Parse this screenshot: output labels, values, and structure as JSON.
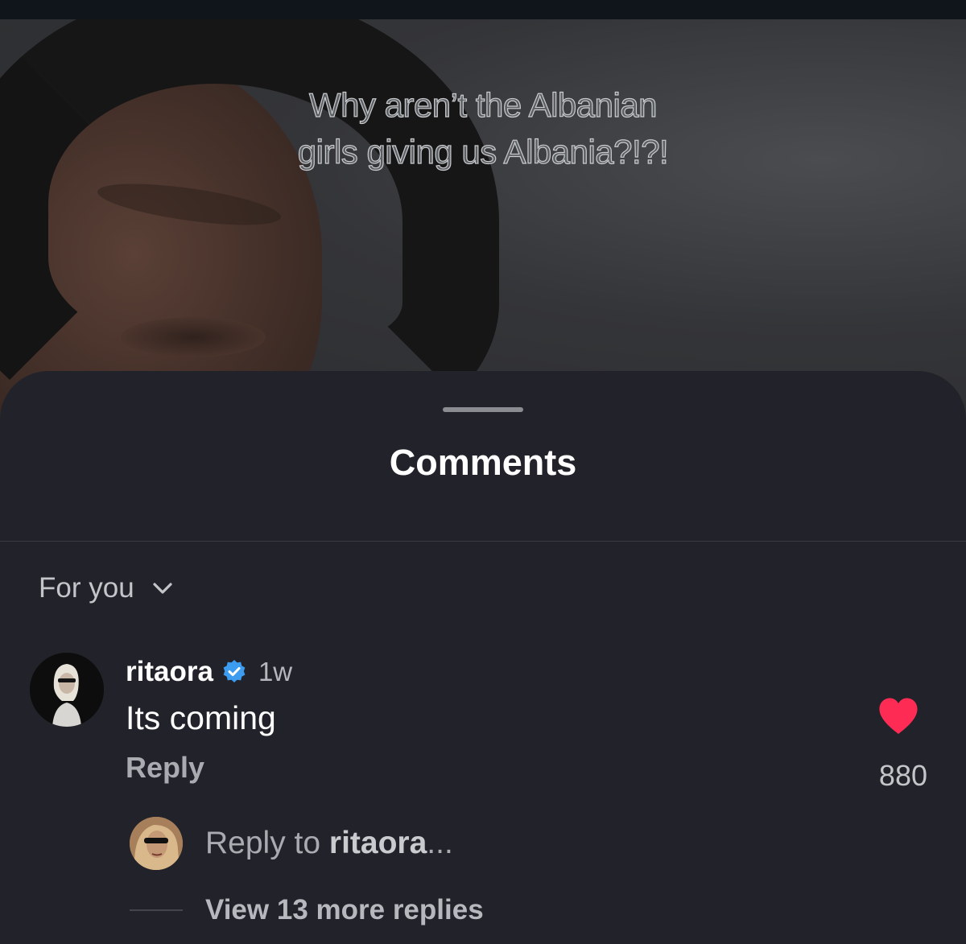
{
  "video": {
    "caption_line1": "Why aren’t the Albanian",
    "caption_line2": "girls giving us Albania?!?!"
  },
  "sheet": {
    "title": "Comments",
    "sort_label": "For you"
  },
  "comment": {
    "username": "ritaora",
    "verified": true,
    "time": "1w",
    "text": "Its coming",
    "reply_label": "Reply",
    "likes": "880",
    "liked": true
  },
  "reply_input": {
    "prefix": "Reply to ",
    "target": "ritaora",
    "suffix": "..."
  },
  "view_more": {
    "label": "View 13 more replies"
  },
  "colors": {
    "sheet_bg": "#22232a",
    "heart": "#fe2c55",
    "verified": "#3b9cf0"
  }
}
